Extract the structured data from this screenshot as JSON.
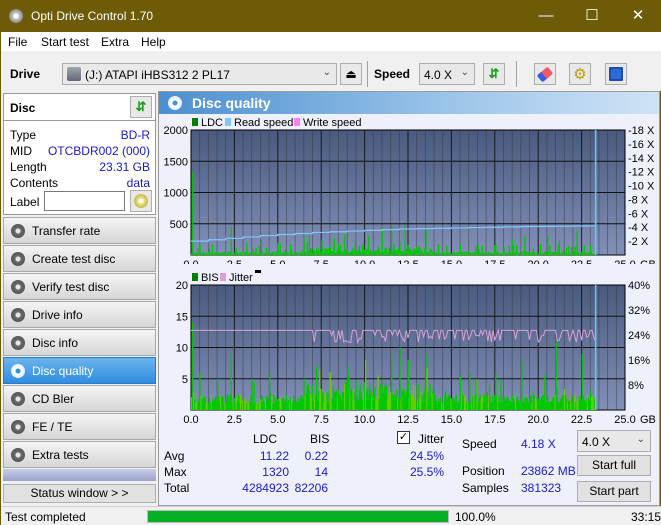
{
  "window": {
    "title": "Opti Drive Control 1.70"
  },
  "menu": [
    "File",
    "Start test",
    "Extra",
    "Help"
  ],
  "toolbar": {
    "drive_label": "Drive",
    "drive_value": "(J:)  ATAPI iHBS312  2 PL17",
    "speed_label": "Speed",
    "speed_value": "4.0 X"
  },
  "disc": {
    "header": "Disc",
    "type_label": "Type",
    "type_value": "BD-R",
    "mid_label": "MID",
    "mid_value": "OTCBDR002 (000)",
    "length_label": "Length",
    "length_value": "23.31 GB",
    "contents_label": "Contents",
    "contents_value": "data",
    "label_label": "Label",
    "label_value": ""
  },
  "nav": [
    {
      "label": "Transfer rate",
      "active": false
    },
    {
      "label": "Create test disc",
      "active": false
    },
    {
      "label": "Verify test disc",
      "active": false
    },
    {
      "label": "Drive info",
      "active": false
    },
    {
      "label": "Disc info",
      "active": false
    },
    {
      "label": "Disc quality",
      "active": true
    },
    {
      "label": "CD Bler",
      "active": false
    },
    {
      "label": "FE / TE",
      "active": false
    },
    {
      "label": "Extra tests",
      "active": false
    }
  ],
  "status_window_label": "Status window > >",
  "panel": {
    "title": "Disc quality"
  },
  "colors": {
    "ldc": "#00c800",
    "read": "#7fc8ff",
    "write": "#ff80ff",
    "bis": "#00c800",
    "jitter": "#d8a0d8",
    "plot_bg_top": "#4a5a7e",
    "plot_bg_bottom": "#8290b8"
  },
  "chart_data": [
    {
      "type": "bar",
      "title": "LDC / Read speed",
      "legend": [
        "LDC",
        "Read speed",
        "Write speed"
      ],
      "xlabel": "GB",
      "x_ticks": [
        "0.0",
        "2.5",
        "5.0",
        "7.5",
        "10.0",
        "12.5",
        "15.0",
        "17.5",
        "20.0",
        "22.5",
        "25.0"
      ],
      "xlim": [
        0,
        25
      ],
      "ylim": [
        0,
        2000
      ],
      "y_ticks": [
        "500",
        "1000",
        "1500",
        "2000"
      ],
      "y2_ticks": [
        "2 X",
        "4 X",
        "6 X",
        "8 X",
        "10 X",
        "12 X",
        "14 X",
        "16 X",
        "18 X"
      ],
      "y2lim": [
        0,
        18
      ],
      "data_end_gb": 23.31,
      "ldc_peaks": [
        [
          0.05,
          1320
        ],
        [
          0.5,
          180
        ],
        [
          1.0,
          120
        ],
        [
          2.3,
          450
        ],
        [
          3.2,
          200
        ],
        [
          4.0,
          250
        ],
        [
          5.0,
          200
        ],
        [
          6.5,
          280
        ],
        [
          6.8,
          320
        ],
        [
          7.5,
          230
        ],
        [
          8.2,
          270
        ],
        [
          8.8,
          330
        ],
        [
          9.4,
          200
        ],
        [
          10.2,
          300
        ],
        [
          11.0,
          430
        ],
        [
          11.5,
          470
        ],
        [
          12.3,
          480
        ],
        [
          13.5,
          420
        ],
        [
          15.5,
          160
        ],
        [
          16.5,
          180
        ],
        [
          18.5,
          250
        ],
        [
          19.2,
          300
        ],
        [
          20.5,
          310
        ],
        [
          21.2,
          250
        ],
        [
          22.2,
          380
        ],
        [
          23.0,
          160
        ]
      ],
      "read_speed": [
        [
          0,
          2.0
        ],
        [
          1,
          2.2
        ],
        [
          2,
          2.4
        ],
        [
          3,
          2.6
        ],
        [
          4,
          2.8
        ],
        [
          5,
          2.95
        ],
        [
          6,
          3.1
        ],
        [
          7,
          3.25
        ],
        [
          8,
          3.35
        ],
        [
          9,
          3.45
        ],
        [
          10,
          3.55
        ],
        [
          11,
          3.65
        ],
        [
          12,
          3.75
        ],
        [
          13,
          3.8
        ],
        [
          14,
          3.85
        ],
        [
          15,
          3.9
        ],
        [
          16,
          3.95
        ],
        [
          17,
          4.0
        ],
        [
          18,
          4.05
        ],
        [
          19,
          4.1
        ],
        [
          20,
          4.12
        ],
        [
          21,
          4.15
        ],
        [
          22,
          4.18
        ],
        [
          23.31,
          4.2
        ]
      ]
    },
    {
      "type": "bar",
      "title": "BIS / Jitter",
      "legend": [
        "BIS",
        "Jitter"
      ],
      "xlabel": "GB",
      "x_ticks": [
        "0.0",
        "2.5",
        "5.0",
        "7.5",
        "10.0",
        "12.5",
        "15.0",
        "17.5",
        "20.0",
        "22.5",
        "25.0"
      ],
      "xlim": [
        0,
        25
      ],
      "ylim": [
        0,
        20
      ],
      "y_ticks": [
        "5",
        "10",
        "15",
        "20"
      ],
      "y2_ticks": [
        "8%",
        "16%",
        "24%",
        "32%",
        "40%"
      ],
      "y2lim": [
        0,
        40
      ],
      "data_end_gb": 23.31,
      "bis_peaks": [
        [
          0.05,
          14
        ],
        [
          0.5,
          6
        ],
        [
          1.5,
          5
        ],
        [
          2.3,
          9
        ],
        [
          3.5,
          5
        ],
        [
          4.5,
          6
        ],
        [
          6.5,
          5
        ],
        [
          7.2,
          7
        ],
        [
          8.0,
          6
        ],
        [
          9.0,
          7
        ],
        [
          10.0,
          8
        ],
        [
          11.5,
          9
        ],
        [
          12.0,
          10
        ],
        [
          12.5,
          8
        ],
        [
          13.5,
          9
        ],
        [
          16.0,
          6
        ],
        [
          17.5,
          6
        ],
        [
          19.0,
          8
        ],
        [
          21.0,
          11
        ],
        [
          22.5,
          9
        ]
      ],
      "jitter_base_pct": 25.5,
      "jitter_dip_pct": 24.0
    }
  ],
  "stats": {
    "col_ldc": "LDC",
    "col_bis": "BIS",
    "jitter_checked": true,
    "jitter_label": "Jitter",
    "avg_label": "Avg",
    "avg_ldc": "11.22",
    "avg_bis": "0.22",
    "avg_jitter": "24.5%",
    "max_label": "Max",
    "max_ldc": "1320",
    "max_bis": "14",
    "max_jitter": "25.5%",
    "total_label": "Total",
    "total_ldc": "4284923",
    "total_bis": "82206",
    "speed_label": "Speed",
    "speed_value": "4.18 X",
    "position_label": "Position",
    "position_value": "23862 MB",
    "samples_label": "Samples",
    "samples_value": "381323",
    "speed_select": "4.0 X",
    "start_full": "Start full",
    "start_part": "Start part"
  },
  "statusbar": {
    "message": "Test completed",
    "progress": 100.0,
    "progress_text": "100.0%",
    "time": "33:15"
  }
}
